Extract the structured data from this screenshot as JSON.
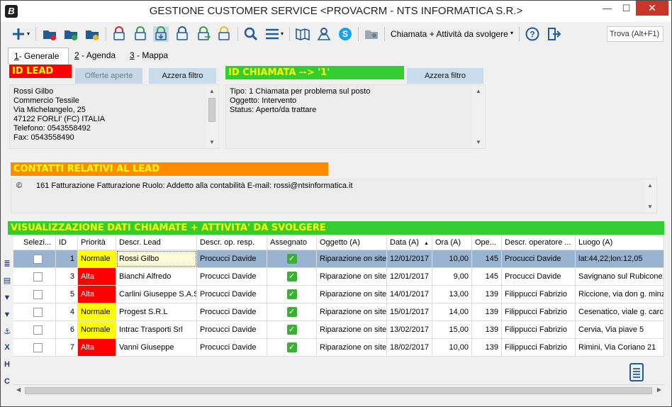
{
  "window": {
    "title": "GESTIONE CUSTOMER SERVICE <PROVACRM - NTS INFORMATICA S.R.>",
    "app_icon_letter": "B",
    "minimize": "—",
    "maximize": "☐",
    "close": "✕"
  },
  "toolbar": {
    "view_label": "Chiamata + Attività da svolgere",
    "search_placeholder": "Trova (Alt+F1)",
    "colors": {
      "red": "#d9251d",
      "green": "#2fa33a",
      "yellow": "#f2b51e",
      "blue": "#1f5c99"
    }
  },
  "tabs": [
    {
      "key": "1",
      "label": "- Generale"
    },
    {
      "key": "2",
      "label": " - Agenda"
    },
    {
      "key": "3",
      "label": " - Mappa"
    }
  ],
  "lead": {
    "header": "ID LEAD",
    "header_color": "#ff0000",
    "offerte_button": "Offerte aperte",
    "azzera_button": "Azzera filtro",
    "lines": [
      "Rossi Gilbo",
      "Commercio Tessile",
      "Via Michelangelo, 25",
      "47122 FORLI' (FC) ITALIA",
      "Telefono: 0543558492",
      "Fax: 0543558490"
    ]
  },
  "call": {
    "header": "ID CHIAMATA --> '1'",
    "header_color": "#33cc33",
    "azzera_button": "Azzera filtro",
    "lines": [
      "Tipo: 1 Chiamata per problema sul posto",
      "Oggetto: Intervento",
      "Status: Aperto/da trattare"
    ]
  },
  "contacts": {
    "header": "CONTATTI RELATIVI AL LEAD",
    "header_color": "#ff8c00",
    "symbol": "©",
    "line": "161 Fatturazione Fatturazione Ruolo: Addetto alla contabilità E-mail: rossi@ntsinformatica.it"
  },
  "grid": {
    "header": "VISUALIZZAZIONE DATI CHIAMATE + ATTIVITA' DA SVOLGERE",
    "header_color": "#33cc33",
    "columns": [
      "Selezi...",
      "ID",
      "Priorità",
      "Descr. Lead",
      "Descr. op. resp.",
      "Assegnato",
      "Oggetto (A)",
      "Data (A)",
      "Ora (A)",
      "Ope...",
      "Descr. operatore ...",
      "Luogo (A)"
    ],
    "sort_indicator": "▲",
    "rows": [
      {
        "id": "1",
        "priority": "Normale",
        "lead": "Rossi Gilbo",
        "op_resp": "Procucci Davide",
        "oggetto": "Riparazione on site",
        "data": "12/01/2017",
        "ora": "10,00",
        "ope": "145",
        "operatore": "Procucci Davide",
        "luogo": "lat:44,22;lon:12,05"
      },
      {
        "id": "3",
        "priority": "Alta",
        "lead": "Bianchi Alfredo",
        "op_resp": "Procucci Davide",
        "oggetto": "Riparazione on site",
        "data": "12/01/2017",
        "ora": "9,00",
        "ope": "145",
        "operatore": "Procucci Davide",
        "luogo": "Savignano sul Rubicone,"
      },
      {
        "id": "5",
        "priority": "Alta",
        "lead": "Carlini Giuseppe S.A.S",
        "op_resp": "Procucci Davide",
        "oggetto": "Riparazione on site",
        "data": "14/01/2017",
        "ora": "13,00",
        "ope": "139",
        "operatore": "Filippucci Fabrizio",
        "luogo": "Riccione, via don g. minz"
      },
      {
        "id": "4",
        "priority": "Normale",
        "lead": "Progest S.R.L",
        "op_resp": "Procucci Davide",
        "oggetto": "Riparazione on site",
        "data": "15/01/2017",
        "ora": "14,00",
        "ope": "139",
        "operatore": "Filippucci Fabrizio",
        "luogo": "Cesenatico, viale g. carc"
      },
      {
        "id": "6",
        "priority": "Normale",
        "lead": "Intrac Trasporti Srl",
        "op_resp": "Procucci Davide",
        "oggetto": "Riparazione on site",
        "data": "13/02/2017",
        "ora": "15,00",
        "ope": "139",
        "operatore": "Filippucci Fabrizio",
        "luogo": "Cervia, Via piave 5"
      },
      {
        "id": "7",
        "priority": "Alta",
        "lead": "Vanni Giuseppe",
        "op_resp": "Procucci Davide",
        "oggetto": "Riparazione on site",
        "data": "18/02/2017",
        "ora": "10,00",
        "ope": "139",
        "operatore": "Filippucci Fabrizio",
        "luogo": "Rimini, Via Coriano 21"
      }
    ],
    "assigned_mark": "✓",
    "selected_row": 0
  },
  "side_icons": [
    "list-icon",
    "grid-icon",
    "filter-icon",
    "filter-clear-icon",
    "anchor-icon",
    "collapse-x-icon",
    "collapse-h-icon",
    "collapse-c-icon"
  ]
}
